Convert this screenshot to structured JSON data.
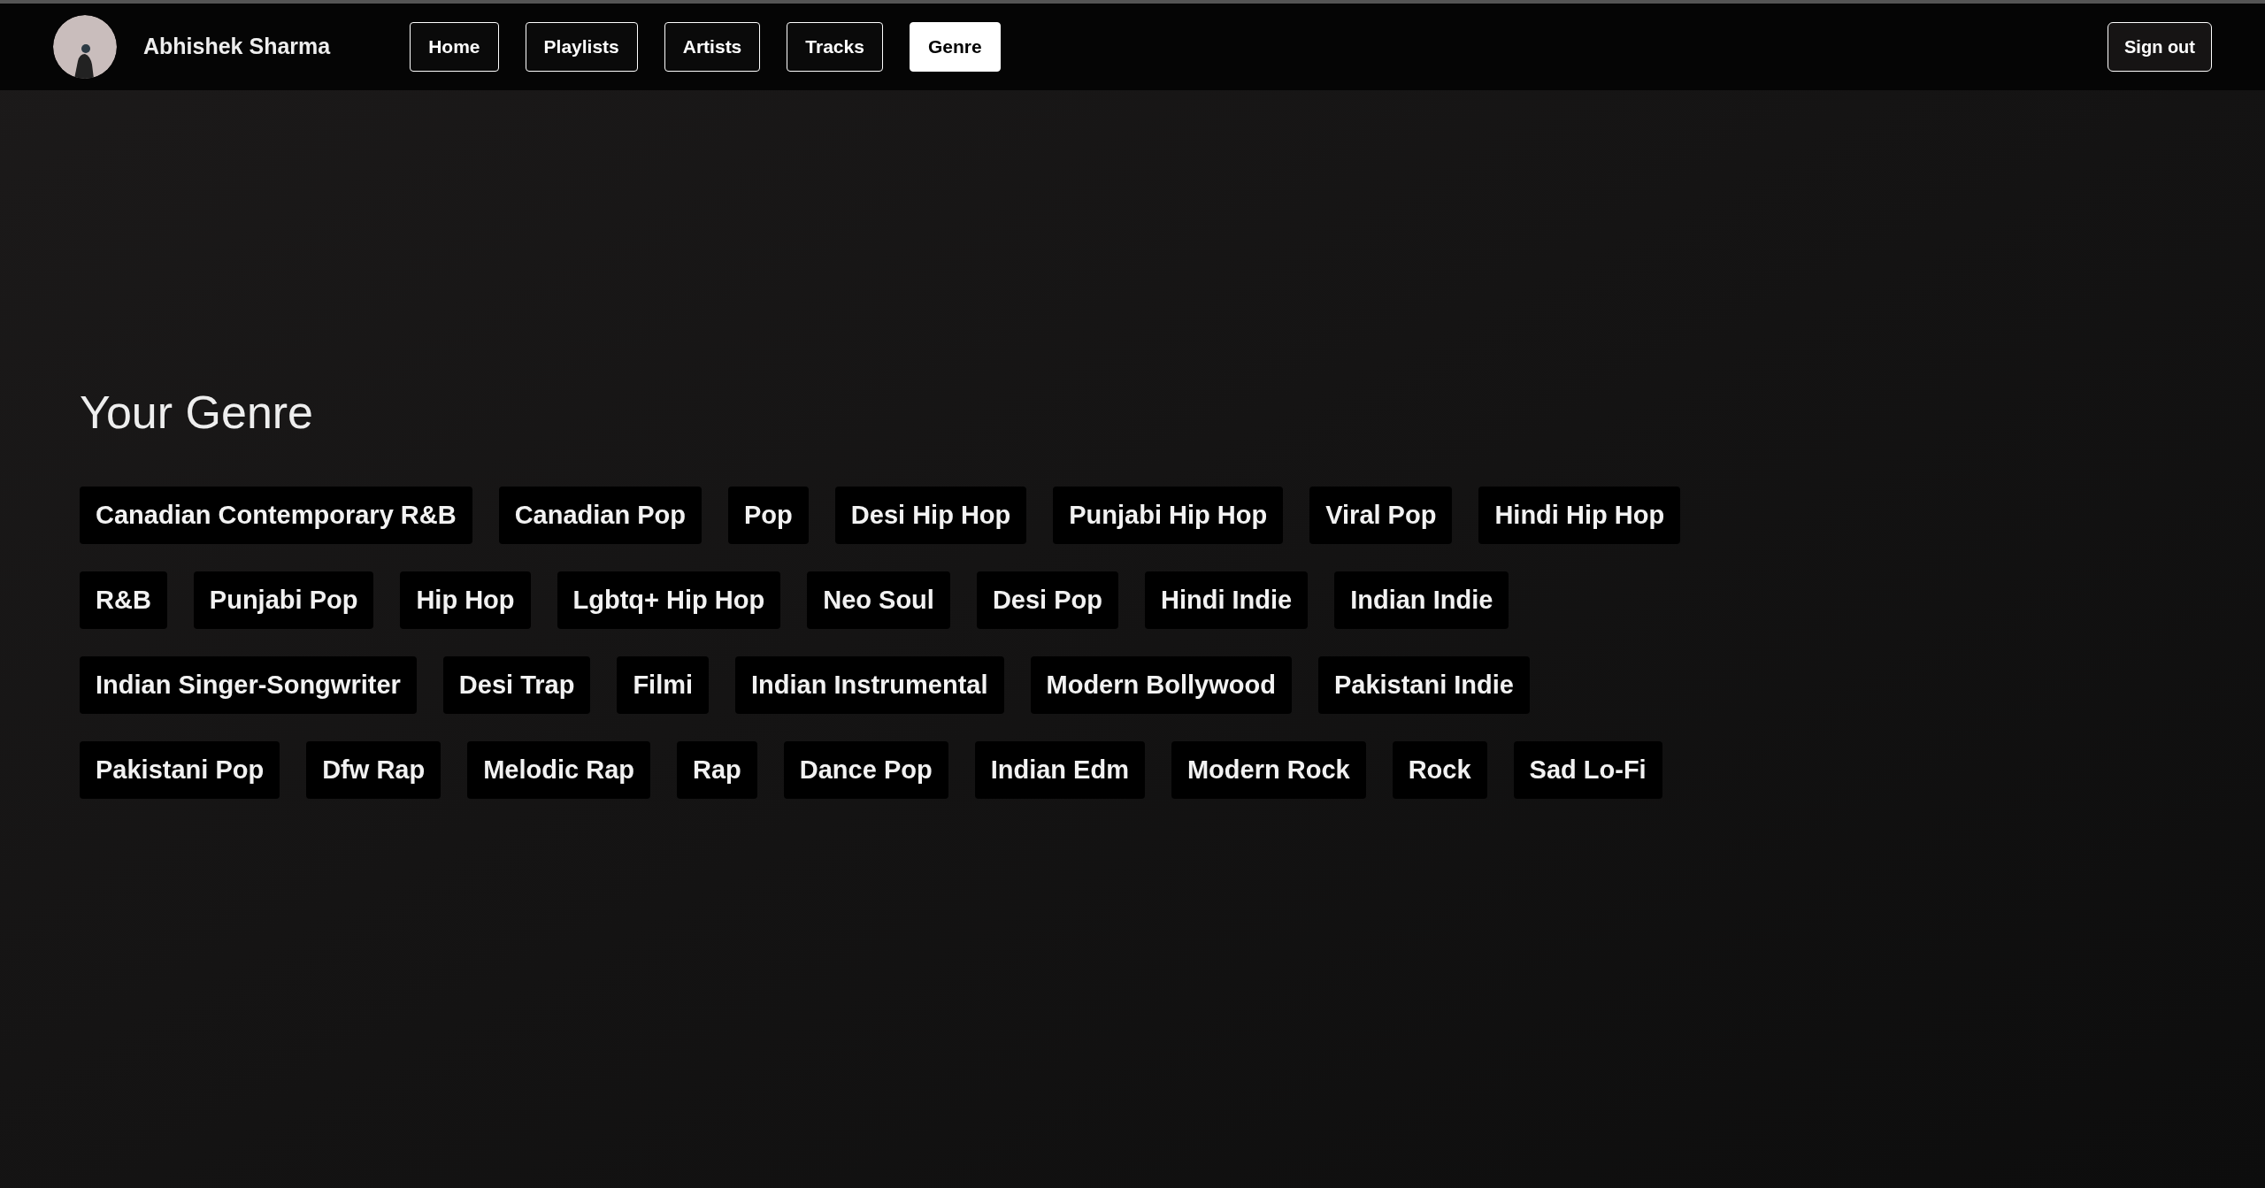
{
  "header": {
    "user_name": "Abhishek Sharma",
    "nav": [
      {
        "label": "Home",
        "selected": false
      },
      {
        "label": "Playlists",
        "selected": false
      },
      {
        "label": "Artists",
        "selected": false
      },
      {
        "label": "Tracks",
        "selected": false
      },
      {
        "label": "Genre",
        "selected": true
      }
    ],
    "sign_out": "Sign out"
  },
  "title": "Your Genre",
  "genre_rows": [
    {
      "genres": [
        "Canadian Contemporary R&B",
        "Canadian Pop",
        "Pop",
        "Desi Hip Hop",
        "Punjabi Hip Hop",
        "Viral Pop",
        "Hindi Hip Hop"
      ]
    },
    {
      "genres": [
        "R&B",
        "Punjabi Pop",
        "Hip Hop",
        "Lgbtq+ Hip Hop",
        "Neo Soul",
        "Desi Pop",
        "Hindi Indie",
        "Indian Indie"
      ]
    },
    {
      "genres": [
        "Indian Singer-Songwriter",
        "Desi Trap",
        "Filmi",
        "Indian Instrumental",
        "Modern Bollywood",
        "Pakistani Indie"
      ]
    },
    {
      "genres": [
        "Pakistani Pop",
        "Dfw Rap",
        "Melodic Rap",
        "Rap",
        "Dance Pop",
        "Indian Edm",
        "Modern Rock",
        "Rock",
        "Sad Lo-Fi"
      ]
    }
  ]
}
